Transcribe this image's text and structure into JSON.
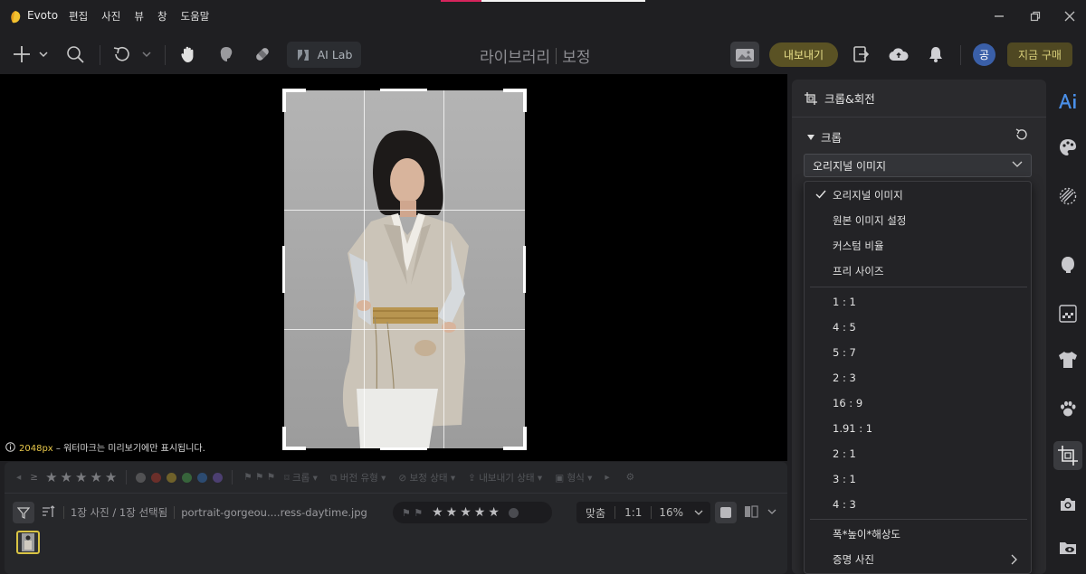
{
  "app": {
    "name": "Evoto"
  },
  "menu": [
    "편집",
    "사진",
    "뷰",
    "창",
    "도움말"
  ],
  "toolbar": {
    "ai_lab_label": "AI Lab",
    "title_library": "라이브러리",
    "title_edit": "보정",
    "export_label": "내보내기",
    "avatar_initial": "공",
    "buy_label": "지금 구매"
  },
  "canvas": {
    "resolution": "2048px",
    "watermark_note": " – 워터마크는 미리보기에만 표시됩니다."
  },
  "filmstrip": {
    "filters": [
      "크롭",
      "버전 유형",
      "보정 상태",
      "내보내기 상태",
      "형식"
    ],
    "label_colors": [
      "#c0392b",
      "#c8a92b",
      "#4caf50",
      "#3478c8",
      "#7b5cc8"
    ],
    "count_text": "1장 사진 / 1장 선택됨",
    "filename": "portrait-gorgeou....ress-daytime.jpg",
    "zoom_fit": "맞춤",
    "zoom_1to1": "1:1",
    "zoom_value": "16%"
  },
  "panel": {
    "title": "크롭&회전",
    "section": "크롭",
    "selected": "오리지널 이미지"
  },
  "dropdown": {
    "group1": [
      "오리지널 이미지",
      "원본 이미지 설정",
      "커스텀 비율",
      "프리 사이즈"
    ],
    "ratios": [
      "1 : 1",
      "4 : 5",
      "5 : 7",
      "2 : 3",
      "16 : 9",
      "1.91 : 1",
      "2 : 1",
      "3 : 1",
      "4 : 3"
    ],
    "group3": [
      "폭*높이*해상도",
      "증명 사진"
    ]
  },
  "colors": {
    "accent_yellow": "#d9c444",
    "export_bg": "#5a5224"
  }
}
